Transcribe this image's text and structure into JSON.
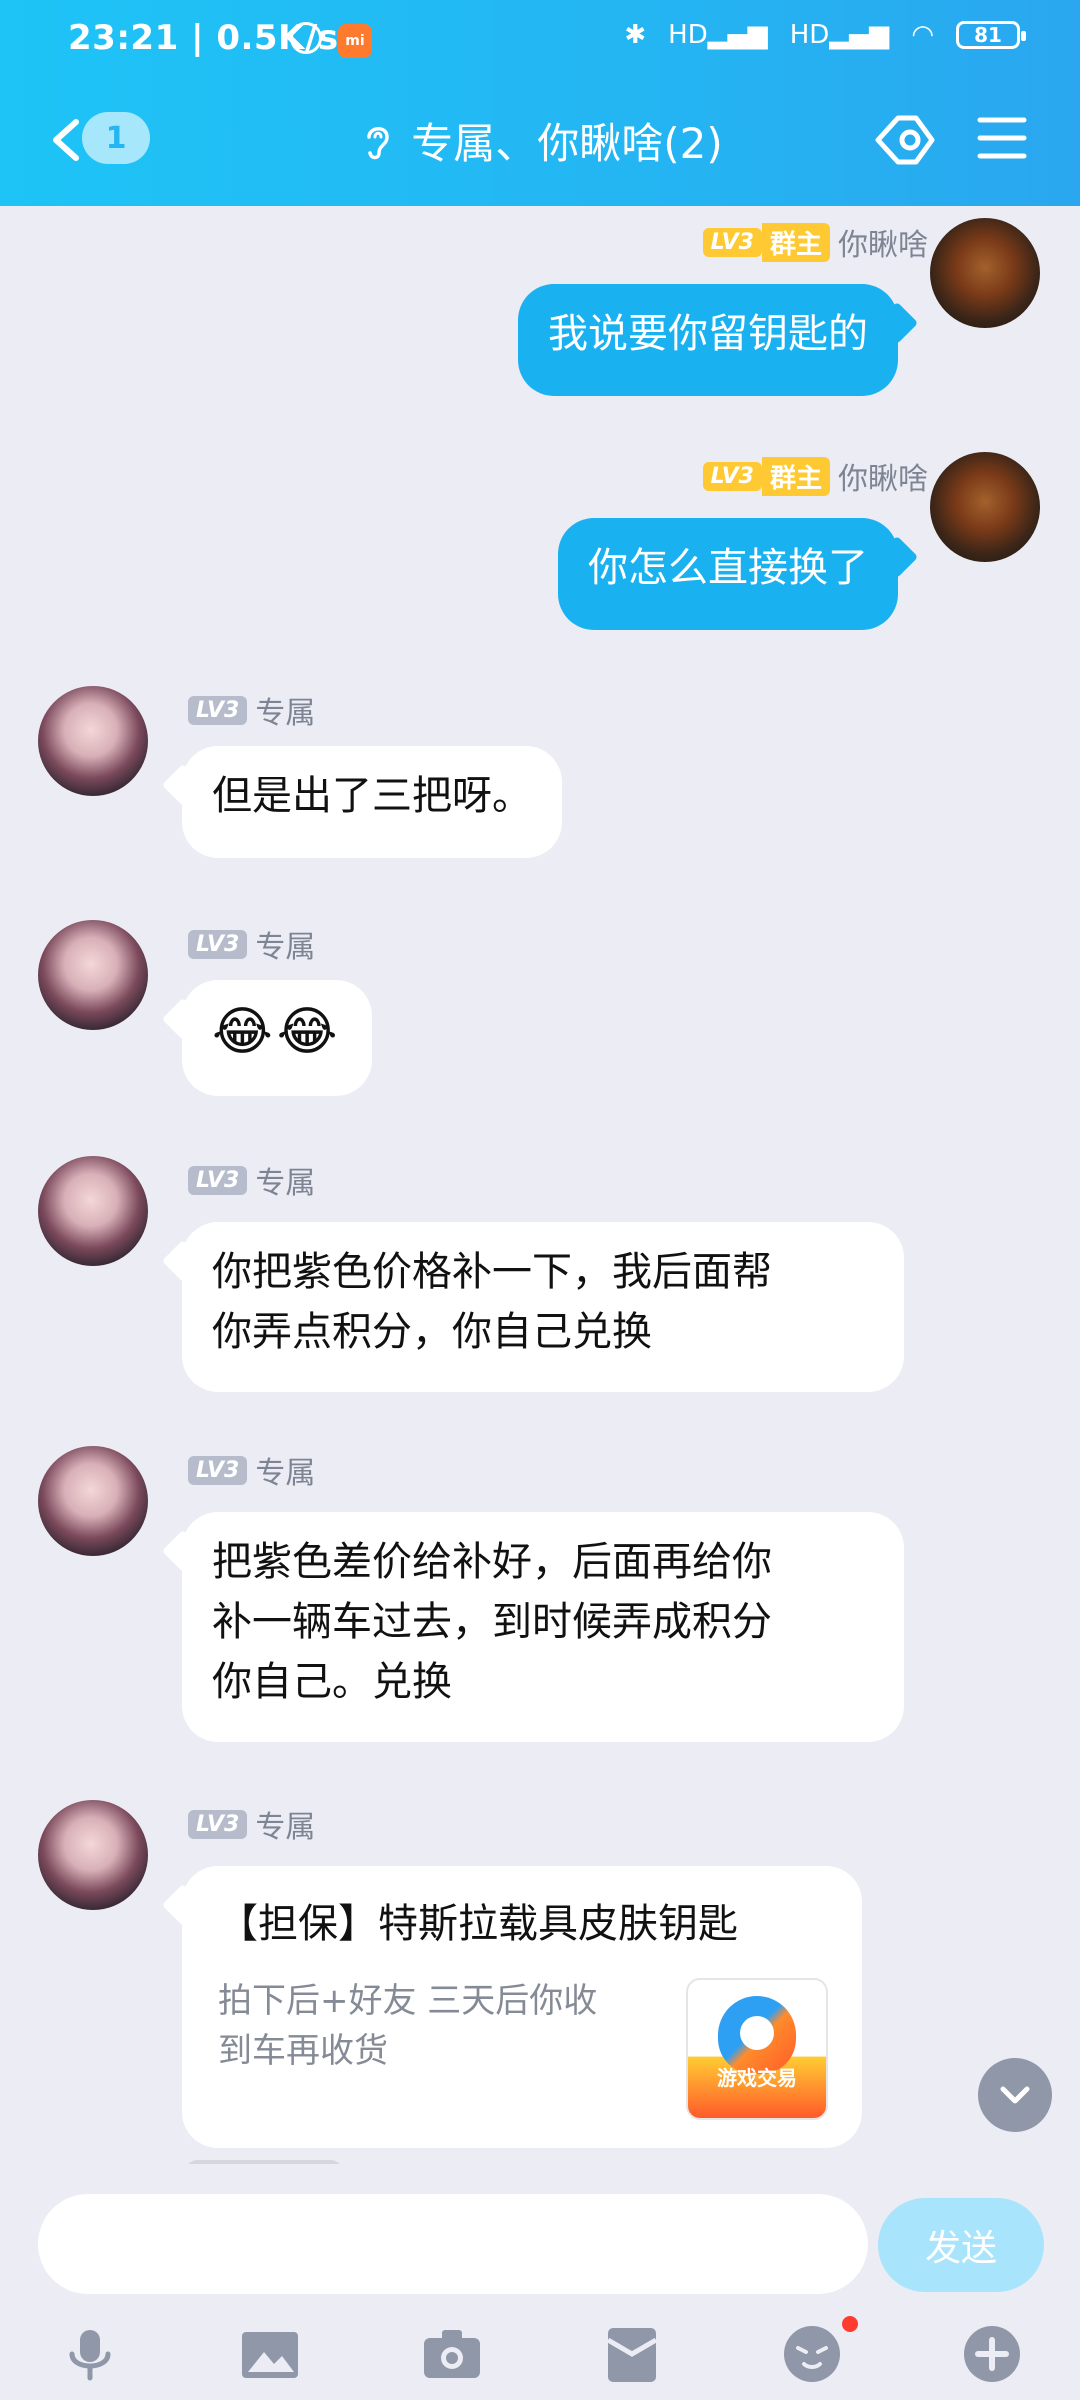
{
  "status_bar": {
    "time": "23:21",
    "speed": "0.5K/s",
    "network": "HD",
    "battery": "81"
  },
  "header": {
    "unread_count": "1",
    "title": "专属、你瞅啥(2)"
  },
  "messages": [
    {
      "side": "self",
      "level": "LV3",
      "role": "群主",
      "sender": "你瞅啥",
      "text": "我说要你留钥匙的"
    },
    {
      "side": "self",
      "level": "LV3",
      "role": "群主",
      "sender": "你瞅啥",
      "text": "你怎么直接换了"
    },
    {
      "side": "other",
      "level": "LV3",
      "sender": "专属",
      "text": "但是出了三把呀。"
    },
    {
      "side": "other",
      "level": "LV3",
      "sender": "专属",
      "text": "😂😂"
    },
    {
      "side": "other",
      "level": "LV3",
      "sender": "专属",
      "text_lines": [
        "你把紫色价格补一下，我后面帮",
        "你弄点积分，你自己兑换"
      ]
    },
    {
      "side": "other",
      "level": "LV3",
      "sender": "专属",
      "text_lines": [
        "把紫色差价给补好，后面再给你",
        "补一辆车过去，到时候弄成积分",
        "你自己。兑换"
      ]
    },
    {
      "side": "other",
      "level": "LV3",
      "sender": "专属",
      "card": {
        "title": "【担保】特斯拉载具皮肤钥匙",
        "desc_lines": [
          "拍下后+好友 三天后你收",
          "到车再收货"
        ],
        "image_caption": "游戏交易"
      }
    }
  ],
  "input": {
    "value": "",
    "send_label": "发送"
  },
  "toolbar": {
    "icons": [
      "microphone-icon",
      "image-icon",
      "camera-icon",
      "red-packet-icon",
      "emoji-icon",
      "plus-icon"
    ]
  },
  "colors": {
    "header": "#24b5f3",
    "self_bubble": "#1ab1f1",
    "other_bubble": "#ffffff",
    "background": "#ececf4",
    "level_badge_gold": "#ffc933",
    "level_badge_gray": "#b6bccb"
  }
}
